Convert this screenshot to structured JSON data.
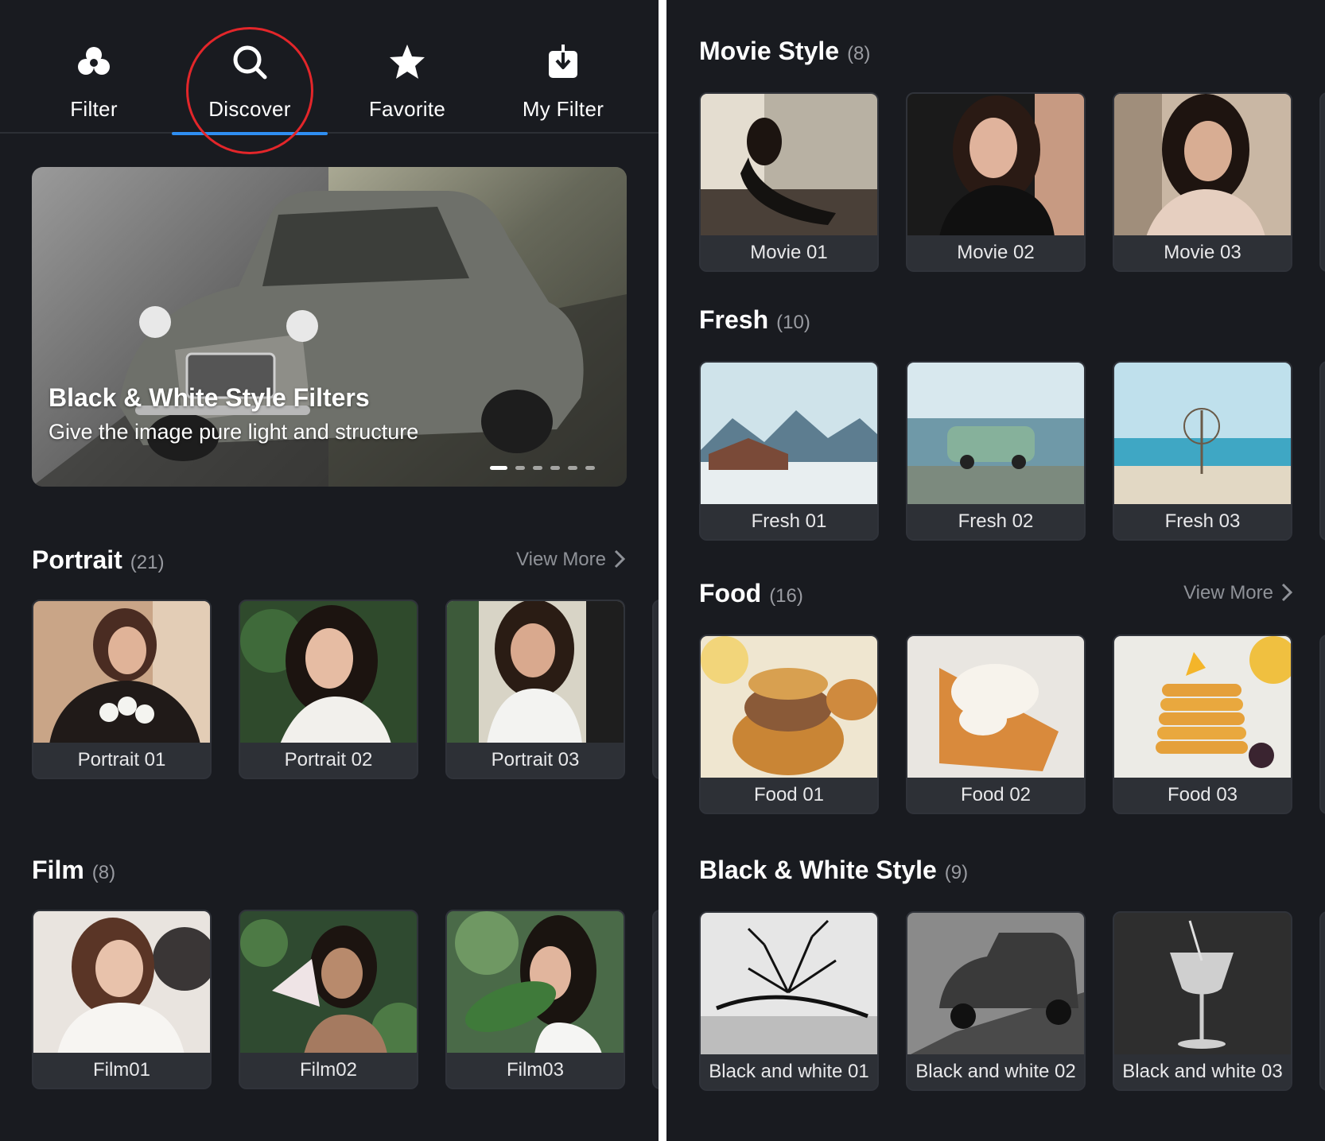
{
  "left": {
    "tabs": [
      {
        "label": "Filter",
        "icon": "filter-circles-icon",
        "active": false
      },
      {
        "label": "Discover",
        "icon": "search-icon",
        "active": true
      },
      {
        "label": "Favorite",
        "icon": "star-icon",
        "active": false
      },
      {
        "label": "My Filter",
        "icon": "download-icon",
        "active": false
      }
    ],
    "banner": {
      "title": "Black & White Style Filters",
      "subtitle": "Give the image pure light and structure",
      "page_count": 6,
      "active_page": 1
    },
    "sections": [
      {
        "title": "Portrait",
        "count": "(21)",
        "view_more": "View More",
        "items": [
          "Portrait 01",
          "Portrait 02",
          "Portrait 03"
        ]
      },
      {
        "title": "Film",
        "count": "(8)",
        "items": [
          "Film01",
          "Film02",
          "Film03"
        ]
      }
    ]
  },
  "right": {
    "sections": [
      {
        "title": "Movie Style",
        "count": "(8)",
        "items": [
          "Movie 01",
          "Movie 02",
          "Movie 03"
        ]
      },
      {
        "title": "Fresh",
        "count": "(10)",
        "items": [
          "Fresh 01",
          "Fresh 02",
          "Fresh 03"
        ]
      },
      {
        "title": "Food",
        "count": "(16)",
        "view_more": "View More",
        "items": [
          "Food 01",
          "Food 02",
          "Food 03"
        ]
      },
      {
        "title": "Black & White Style",
        "count": "(9)",
        "items": [
          "Black and white 01",
          "Black and white 02",
          "Black and white 03"
        ]
      }
    ]
  },
  "colors": {
    "background": "#191b20",
    "accent_underline": "#2f8ff2",
    "highlight_circle": "#e3262a",
    "card_caption_bg": "#2d3036"
  }
}
